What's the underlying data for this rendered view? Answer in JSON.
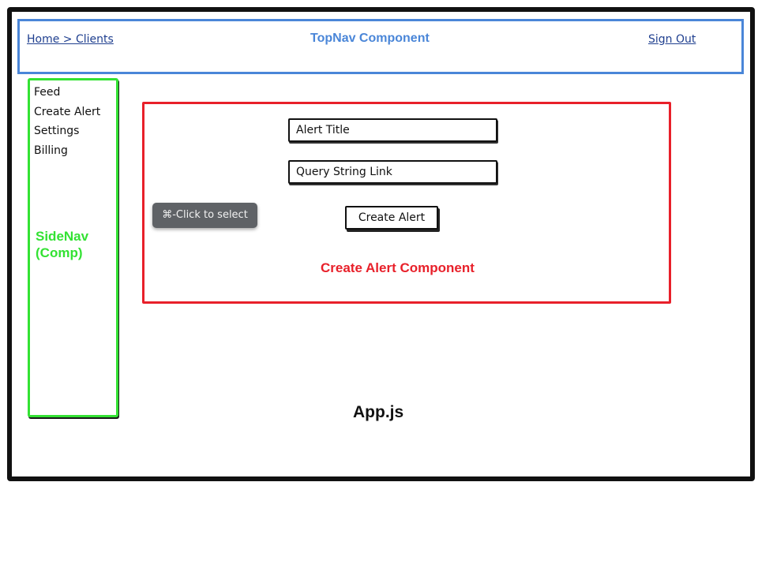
{
  "topnav": {
    "breadcrumb": "Home > Clients",
    "title": "TopNav Component",
    "sign_out": "Sign Out",
    "border_color": "#4a86d8"
  },
  "sidenav": {
    "items": [
      {
        "label": "Feed"
      },
      {
        "label": "Create Alert"
      },
      {
        "label": "Settings"
      },
      {
        "label": "Billing"
      }
    ],
    "label_line1": "SideNav",
    "label_line2": "(Comp)",
    "border_color": "#33e233"
  },
  "create_alert": {
    "title_field_placeholder": "Alert Title",
    "query_field_placeholder": "Query String Link",
    "button_label": "Create Alert",
    "component_label": "Create Alert Component",
    "border_color": "#e8202a"
  },
  "tooltip": {
    "label": "⌘-Click to select"
  },
  "app": {
    "label": "App.js"
  }
}
